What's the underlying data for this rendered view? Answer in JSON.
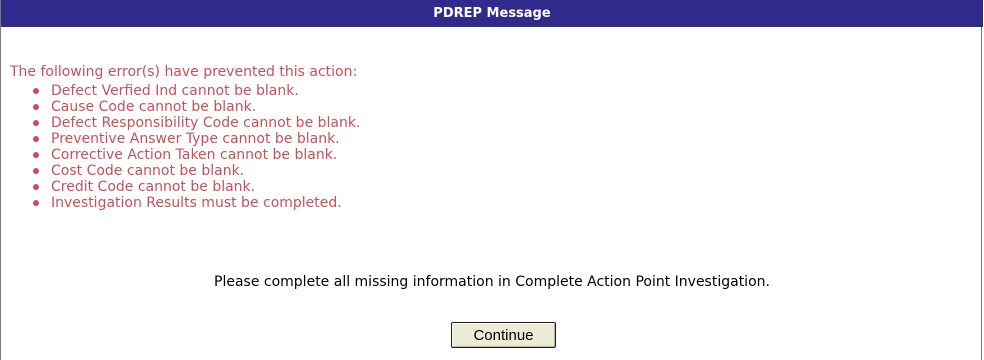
{
  "dialog": {
    "title": "PDREP Message",
    "error_intro": "The following error(s) have prevented this action:",
    "errors": [
      "Defect Verfied Ind cannot be blank.",
      "Cause Code cannot be blank.",
      "Defect Responsibility Code cannot be blank.",
      "Preventive Answer Type cannot be blank.",
      "Corrective Action Taken cannot be blank.",
      "Cost Code cannot be blank.",
      "Credit Code cannot be blank.",
      "Investigation Results must be completed."
    ],
    "instruction": "Please complete all missing information in Complete Action Point Investigation.",
    "continue_label": "Continue"
  },
  "colors": {
    "title_bar": "#2f2a8c",
    "error_text": "#c8505a",
    "button_face": "#ecebd6"
  }
}
